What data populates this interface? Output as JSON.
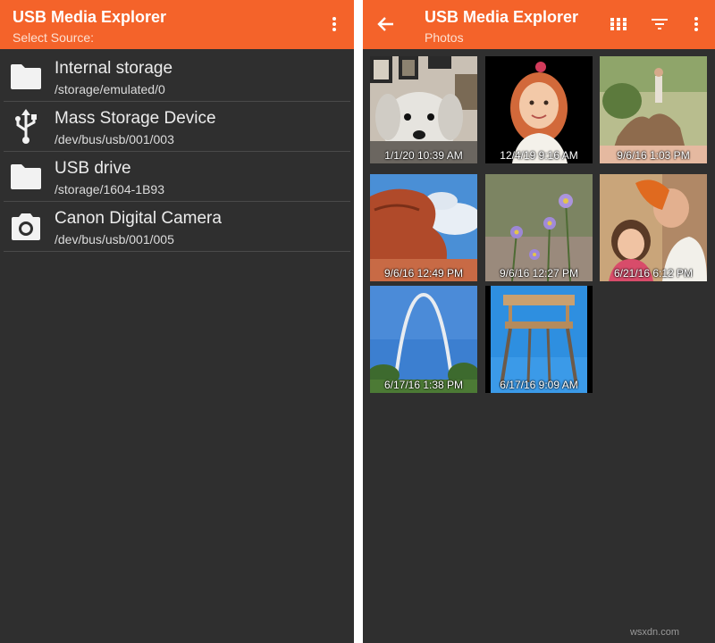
{
  "left_screen": {
    "title": "USB Media Explorer",
    "subtitle": "Select Source:",
    "sources": [
      {
        "name": "Internal storage",
        "path": "/storage/emulated/0",
        "icon": "folder-icon"
      },
      {
        "name": "Mass Storage Device",
        "path": "/dev/bus/usb/001/003",
        "icon": "usb-icon"
      },
      {
        "name": "USB drive",
        "path": "/storage/1604-1B93",
        "icon": "folder-icon"
      },
      {
        "name": "Canon Digital Camera",
        "path": "/dev/bus/usb/001/005",
        "icon": "camera-icon"
      }
    ]
  },
  "right_screen": {
    "title": "USB Media Explorer",
    "subtitle": "Photos",
    "photos": [
      {
        "date": "1/1/20 10:39 AM",
        "subject": "dog"
      },
      {
        "date": "12/4/19 9:16 AM",
        "subject": "girl portrait"
      },
      {
        "date": "9/6/16 1:03 PM",
        "subject": "woman on rock"
      },
      {
        "date": "9/6/16 12:49 PM",
        "subject": "red rock"
      },
      {
        "date": "9/6/16 12:27 PM",
        "subject": "purple flowers"
      },
      {
        "date": "6/21/16 6:12 PM",
        "subject": "girl with man"
      },
      {
        "date": "6/17/16 1:38 PM",
        "subject": "gateway arch"
      },
      {
        "date": "6/17/16 9:09 AM",
        "subject": "giant chair"
      }
    ]
  },
  "colors": {
    "accent": "#f4632a",
    "background": "#2f2f2f"
  },
  "watermark": "wsxdn.com"
}
